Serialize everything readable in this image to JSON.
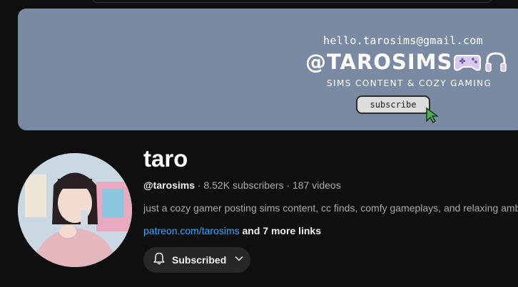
{
  "banner": {
    "email": "hello.tarosims@gmail.com",
    "handle": "@TAROSIMS",
    "tagline": "SIMS CONTENT & COZY GAMING",
    "subscribe_label": "subscribe",
    "icons": [
      "gamepad-icon",
      "headphones-icon",
      "cursor-icon"
    ],
    "background_color": "#7a8aa3"
  },
  "channel": {
    "name": "taro",
    "handle": "@tarosims",
    "separator": " · ",
    "subscribers": "8.52K subscribers",
    "videos": "187 videos",
    "description": "just a cozy gamer posting sims content, cc finds, comfy gameplays, and relaxing ambience",
    "link": "patreon.com/tarosims",
    "more_links": "and 7 more links"
  },
  "subscribe_button": {
    "label": "Subscribed",
    "icons": [
      "bell-icon",
      "chevron-down-icon"
    ]
  },
  "colors": {
    "background": "#0f0f0f",
    "link": "#3ea6ff",
    "button": "#272727"
  }
}
